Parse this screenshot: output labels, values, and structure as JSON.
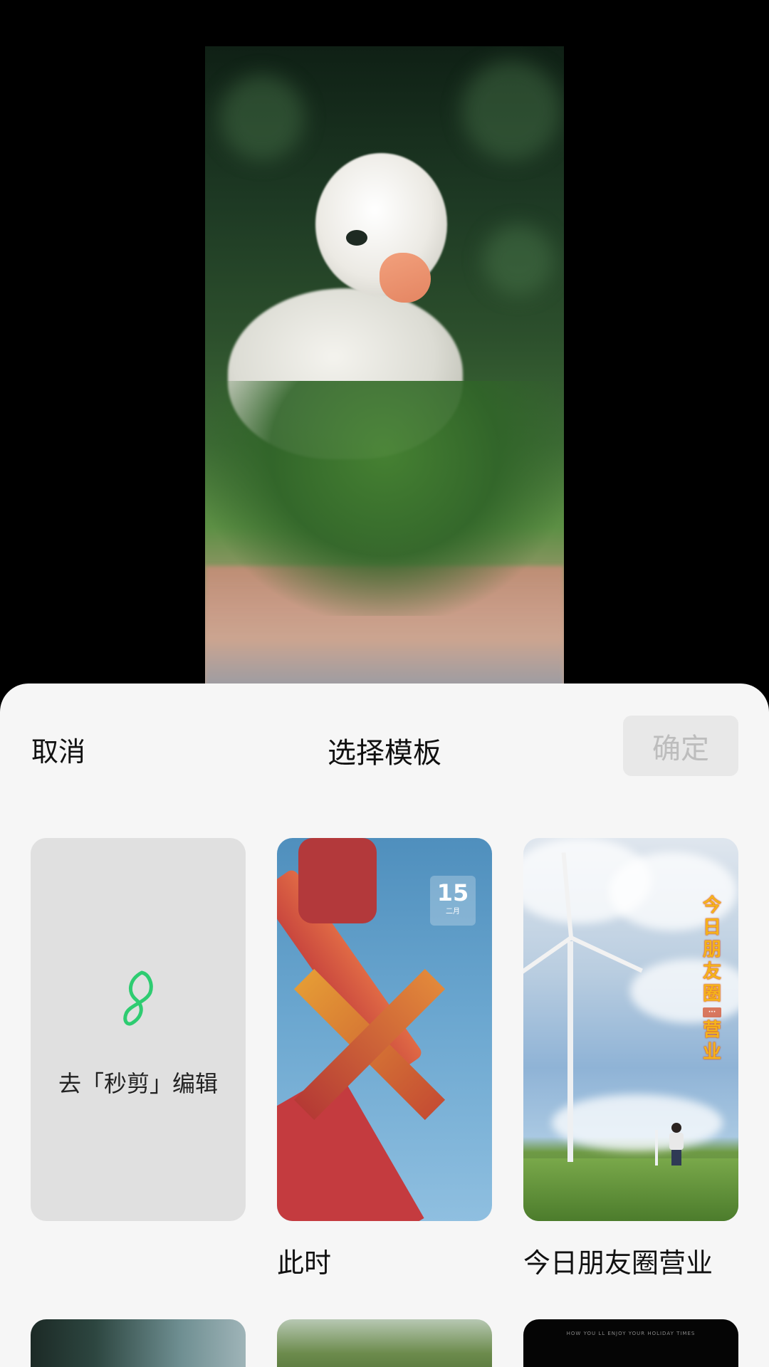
{
  "header": {
    "cancel_label": "取消",
    "title": "选择模板",
    "confirm_label": "确定"
  },
  "templates": [
    {
      "id_label": "edit",
      "label": "去「秒剪」编辑",
      "icon": "miaojian-logo-icon",
      "accent": "#2ecc71"
    },
    {
      "id_label": "cishi",
      "caption": "此时",
      "date_day": "15",
      "date_month": "二月"
    },
    {
      "id_label": "pengyouquan",
      "caption": "今日朋友圈营业",
      "overlay_title": "今日朋友圈",
      "overlay_tag": "营业"
    }
  ],
  "row2_caption_hint": "HOW YOU LL ENJOY YOUR HOLIDAY TIMES",
  "colors": {
    "sheet_bg": "#f6f6f6",
    "confirm_disabled_bg": "#e8e8e8",
    "confirm_disabled_text": "#bdbdbd",
    "logo_green": "#2ecc71"
  }
}
